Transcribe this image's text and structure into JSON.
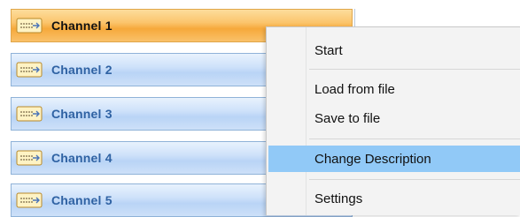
{
  "channels": [
    {
      "label": "Channel 1",
      "selected": true
    },
    {
      "label": "Channel 2",
      "selected": false
    },
    {
      "label": "Channel 3",
      "selected": false
    },
    {
      "label": "Channel 4",
      "selected": false
    },
    {
      "label": "Channel 5",
      "selected": false
    }
  ],
  "context_menu": {
    "start_label": "Start",
    "load_label": "Load from file",
    "save_label": "Save to file",
    "change_description_label": "Change Description",
    "settings_label": "Settings",
    "highlighted_item": "Change Description"
  },
  "colors": {
    "selected_row": "#f6a93b",
    "normal_row": "#b9d4f6",
    "menu_highlight": "#91c9f7",
    "channel_text": "#2f62a3"
  },
  "icons": {
    "channel_icon": "channel-connector-icon"
  }
}
